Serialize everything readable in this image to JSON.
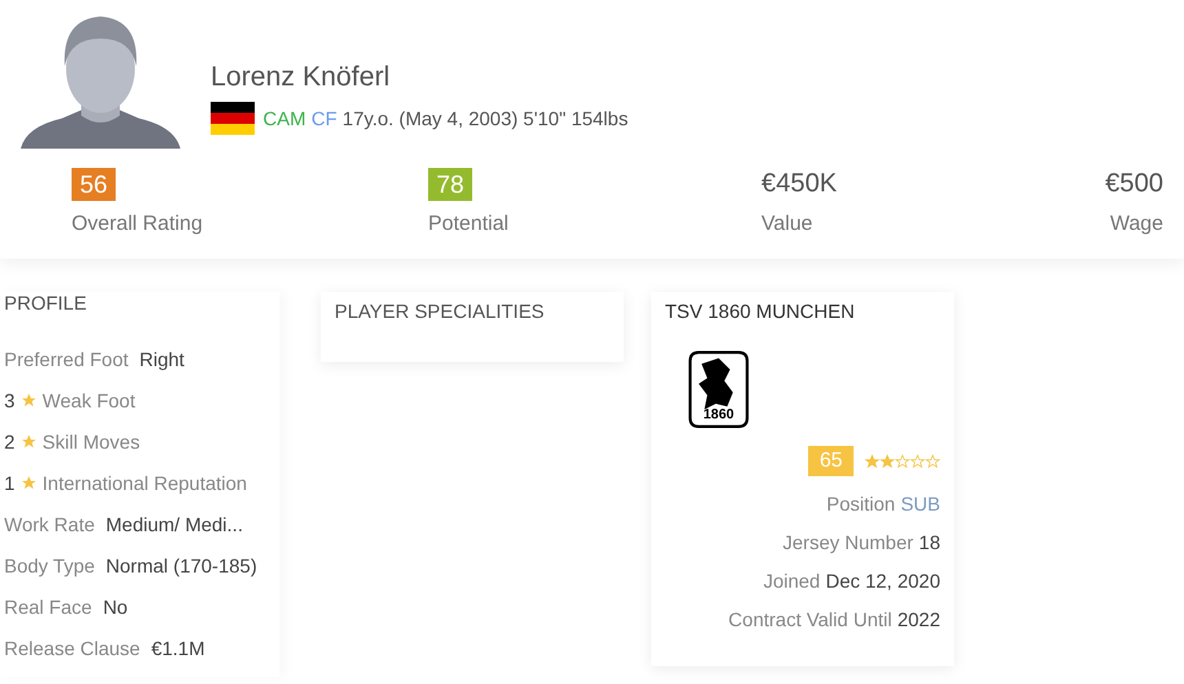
{
  "player": {
    "name": "Lorenz Knöferl",
    "positions": [
      {
        "label": "CAM",
        "color": "#3cb44b"
      },
      {
        "label": "CF",
        "color": "#6a9cf0"
      }
    ],
    "details": "17y.o. (May 4, 2003) 5'10\" 154lbs"
  },
  "stats": [
    {
      "value": "56",
      "label": "Overall Rating",
      "color": "#e67e22"
    },
    {
      "value": "78",
      "label": "Potential",
      "color": "#94bb2e"
    },
    {
      "value": "€450K",
      "label": "Value"
    },
    {
      "value": "€500",
      "label": "Wage"
    }
  ],
  "profile": {
    "title": "PROFILE",
    "rows": [
      {
        "kind": "pair",
        "label": "Preferred Foot",
        "value": "Right"
      },
      {
        "kind": "star",
        "value": "3",
        "label": "Weak Foot"
      },
      {
        "kind": "star",
        "value": "2",
        "label": "Skill Moves"
      },
      {
        "kind": "star",
        "value": "1",
        "label": "International Reputation"
      },
      {
        "kind": "pair",
        "label": "Work Rate",
        "value": "Medium/ Medi..."
      },
      {
        "kind": "pair",
        "label": "Body Type",
        "value": "Normal (170-185)"
      },
      {
        "kind": "pair",
        "label": "Real Face",
        "value": "No"
      },
      {
        "kind": "pair",
        "label": "Release Clause",
        "value": "€1.1M"
      }
    ]
  },
  "specialities": {
    "title": "PLAYER SPECIALITIES"
  },
  "club": {
    "title": "TSV 1860 MUNCHEN",
    "crest_text": "1860",
    "rating": "65",
    "stars": 2,
    "rows": [
      {
        "label": "Position",
        "value": "SUB",
        "kind": "link"
      },
      {
        "label": "Jersey Number",
        "value": "18",
        "kind": "plain"
      },
      {
        "label": "Joined",
        "value": "Dec 12, 2020",
        "kind": "plain"
      },
      {
        "label": "Contract Valid Until",
        "value": "2022",
        "kind": "plain"
      }
    ]
  }
}
